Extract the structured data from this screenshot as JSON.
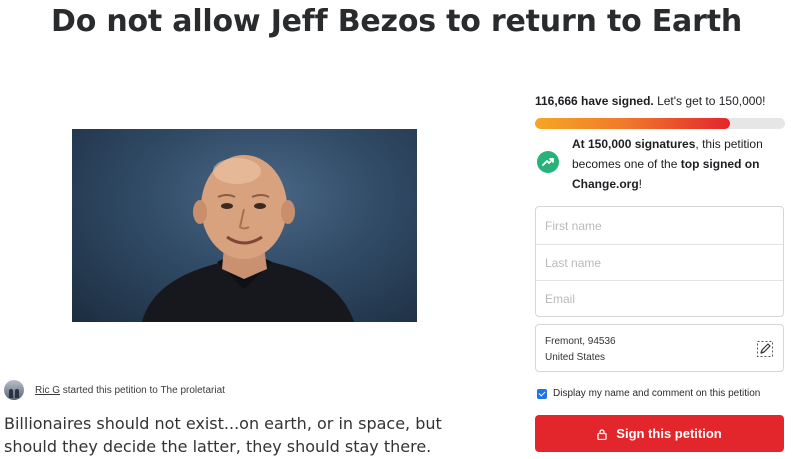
{
  "petition": {
    "title": "Do not allow Jeff Bezos to return to Earth",
    "photo_icon": "photo-of-man-in-black-shirt",
    "starter": {
      "name": "Ric G",
      "action": " started this petition to ",
      "target": "The proletariat"
    },
    "description": "Billionaires should not exist...on earth, or in space, but should they decide the latter, they should stay there."
  },
  "signatures": {
    "count": "116,666 have signed.",
    "goal_text": " Let's get to 150,000!",
    "progress_fraction": 0.78
  },
  "milestone": {
    "icon": "trending-up-icon",
    "bold1": "At 150,000 signatures",
    "text1": ", this petition becomes one of the ",
    "bold2": "top signed on Change.org",
    "text2": "!"
  },
  "form": {
    "first_name_placeholder": "First name",
    "last_name_placeholder": "Last name",
    "email_placeholder": "Email",
    "location_line1": "Fremont, 94536",
    "location_line2": "United States",
    "consent_label": "Display my name and comment on this petition",
    "consent_checked": true,
    "sign_button_label": "Sign this petition"
  },
  "colors": {
    "sign_button": "#e3262c",
    "progress_start": "#f5a623",
    "progress_end": "#e3262c",
    "milestone_icon": "#27b27a",
    "checkbox": "#1a73e8"
  }
}
